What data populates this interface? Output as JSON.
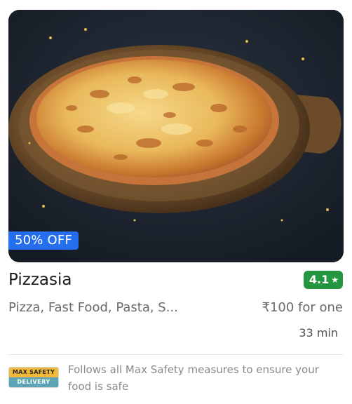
{
  "restaurant": {
    "name": "Pizzasia",
    "rating": "4.1",
    "cuisines": "Pizza, Fast Food, Pasta, S...",
    "price": "₹100 for one",
    "delivery_time": "33 min",
    "offer": "50% OFF"
  },
  "safety": {
    "logo_top": "MAX SAFETY",
    "logo_bottom": "DELIVERY",
    "text": "Follows all Max Safety measures to ensure your food is safe"
  },
  "colors": {
    "rating_bg": "#24963f",
    "offer_bg": "#256fef"
  }
}
